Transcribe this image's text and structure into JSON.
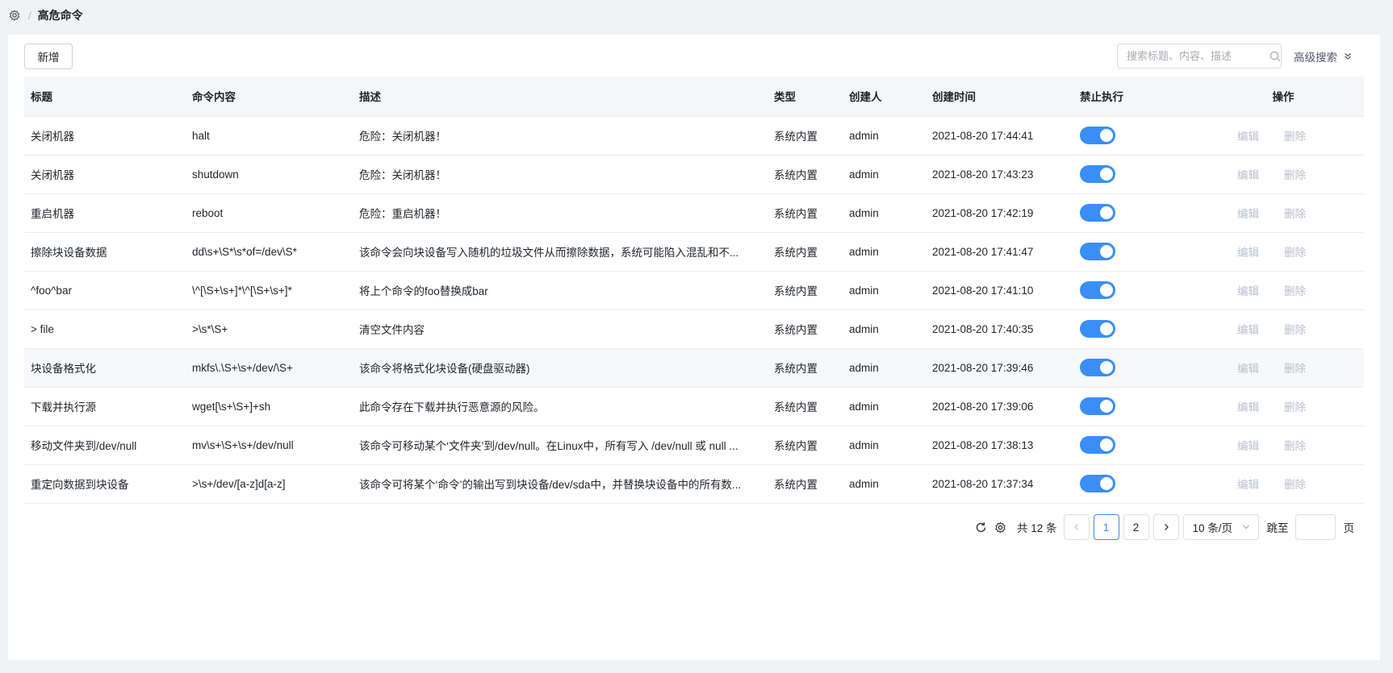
{
  "breadcrumb": {
    "current": "高危命令"
  },
  "toolbar": {
    "add_label": "新增",
    "search_placeholder": "搜索标题、内容、描述",
    "advanced_search_label": "高级搜索"
  },
  "table": {
    "columns": {
      "title": "标题",
      "command": "命令内容",
      "description": "描述",
      "type": "类型",
      "creator": "创建人",
      "created_at": "创建时间",
      "forbid": "禁止执行",
      "actions": "操作"
    },
    "action_labels": {
      "edit": "编辑",
      "delete": "删除"
    },
    "rows": [
      {
        "title": "关闭机器",
        "command": "halt",
        "description": "危险：关闭机器！",
        "type": "系统内置",
        "creator": "admin",
        "created_at": "2021-08-20 17:44:41",
        "forbid": true
      },
      {
        "title": "关闭机器",
        "command": "shutdown",
        "description": "危险：关闭机器！",
        "type": "系统内置",
        "creator": "admin",
        "created_at": "2021-08-20 17:43:23",
        "forbid": true
      },
      {
        "title": "重启机器",
        "command": "reboot",
        "description": "危险：重启机器！",
        "type": "系统内置",
        "creator": "admin",
        "created_at": "2021-08-20 17:42:19",
        "forbid": true
      },
      {
        "title": "擦除块设备数据",
        "command": "dd\\s+\\S*\\s*of=/dev\\S*",
        "description": "该命令会向块设备写入随机的垃圾文件从而擦除数据，系统可能陷入混乱和不...",
        "type": "系统内置",
        "creator": "admin",
        "created_at": "2021-08-20 17:41:47",
        "forbid": true
      },
      {
        "title": "^foo^bar",
        "command": "\\^[\\S+\\s+]*\\^[\\S+\\s+]*",
        "description": "将上个命令的foo替换成bar",
        "type": "系统内置",
        "creator": "admin",
        "created_at": "2021-08-20 17:41:10",
        "forbid": true
      },
      {
        "title": "> file",
        "command": ">\\s*\\S+",
        "description": "清空文件内容",
        "type": "系统内置",
        "creator": "admin",
        "created_at": "2021-08-20 17:40:35",
        "forbid": true
      },
      {
        "title": "块设备格式化",
        "command": "mkfs\\.\\S+\\s+/dev/\\S+",
        "description": "该命令将格式化块设备(硬盘驱动器)",
        "type": "系统内置",
        "creator": "admin",
        "created_at": "2021-08-20 17:39:46",
        "forbid": true
      },
      {
        "title": "下载并执行源",
        "command": "wget[\\s+\\S+]+sh",
        "description": "此命令存在下载并执行恶意源的风险。",
        "type": "系统内置",
        "creator": "admin",
        "created_at": "2021-08-20 17:39:06",
        "forbid": true
      },
      {
        "title": "移动文件夹到/dev/null",
        "command": "mv\\s+\\S+\\s+/dev/null",
        "description": "该命令可移动某个‘文件夹’到/dev/null。在Linux中，所有写入 /dev/null 或 null ...",
        "type": "系统内置",
        "creator": "admin",
        "created_at": "2021-08-20 17:38:13",
        "forbid": true
      },
      {
        "title": "重定向数据到块设备",
        "command": ">\\s+/dev/[a-z]d[a-z]",
        "description": "该命令可将某个‘命令’的输出写到块设备/dev/sda中，并替换块设备中的所有数...",
        "type": "系统内置",
        "creator": "admin",
        "created_at": "2021-08-20 17:37:34",
        "forbid": true
      }
    ]
  },
  "pagination": {
    "total_text": "共 12 条",
    "pages": [
      "1",
      "2"
    ],
    "current_page": "1",
    "page_size": "10 条/页",
    "jump_label": "跳至",
    "page_suffix": "页"
  },
  "colors": {
    "accent": "#3a8ef6",
    "disabled_action": "#b6c0cf",
    "header_bg": "#f5f6f7"
  }
}
